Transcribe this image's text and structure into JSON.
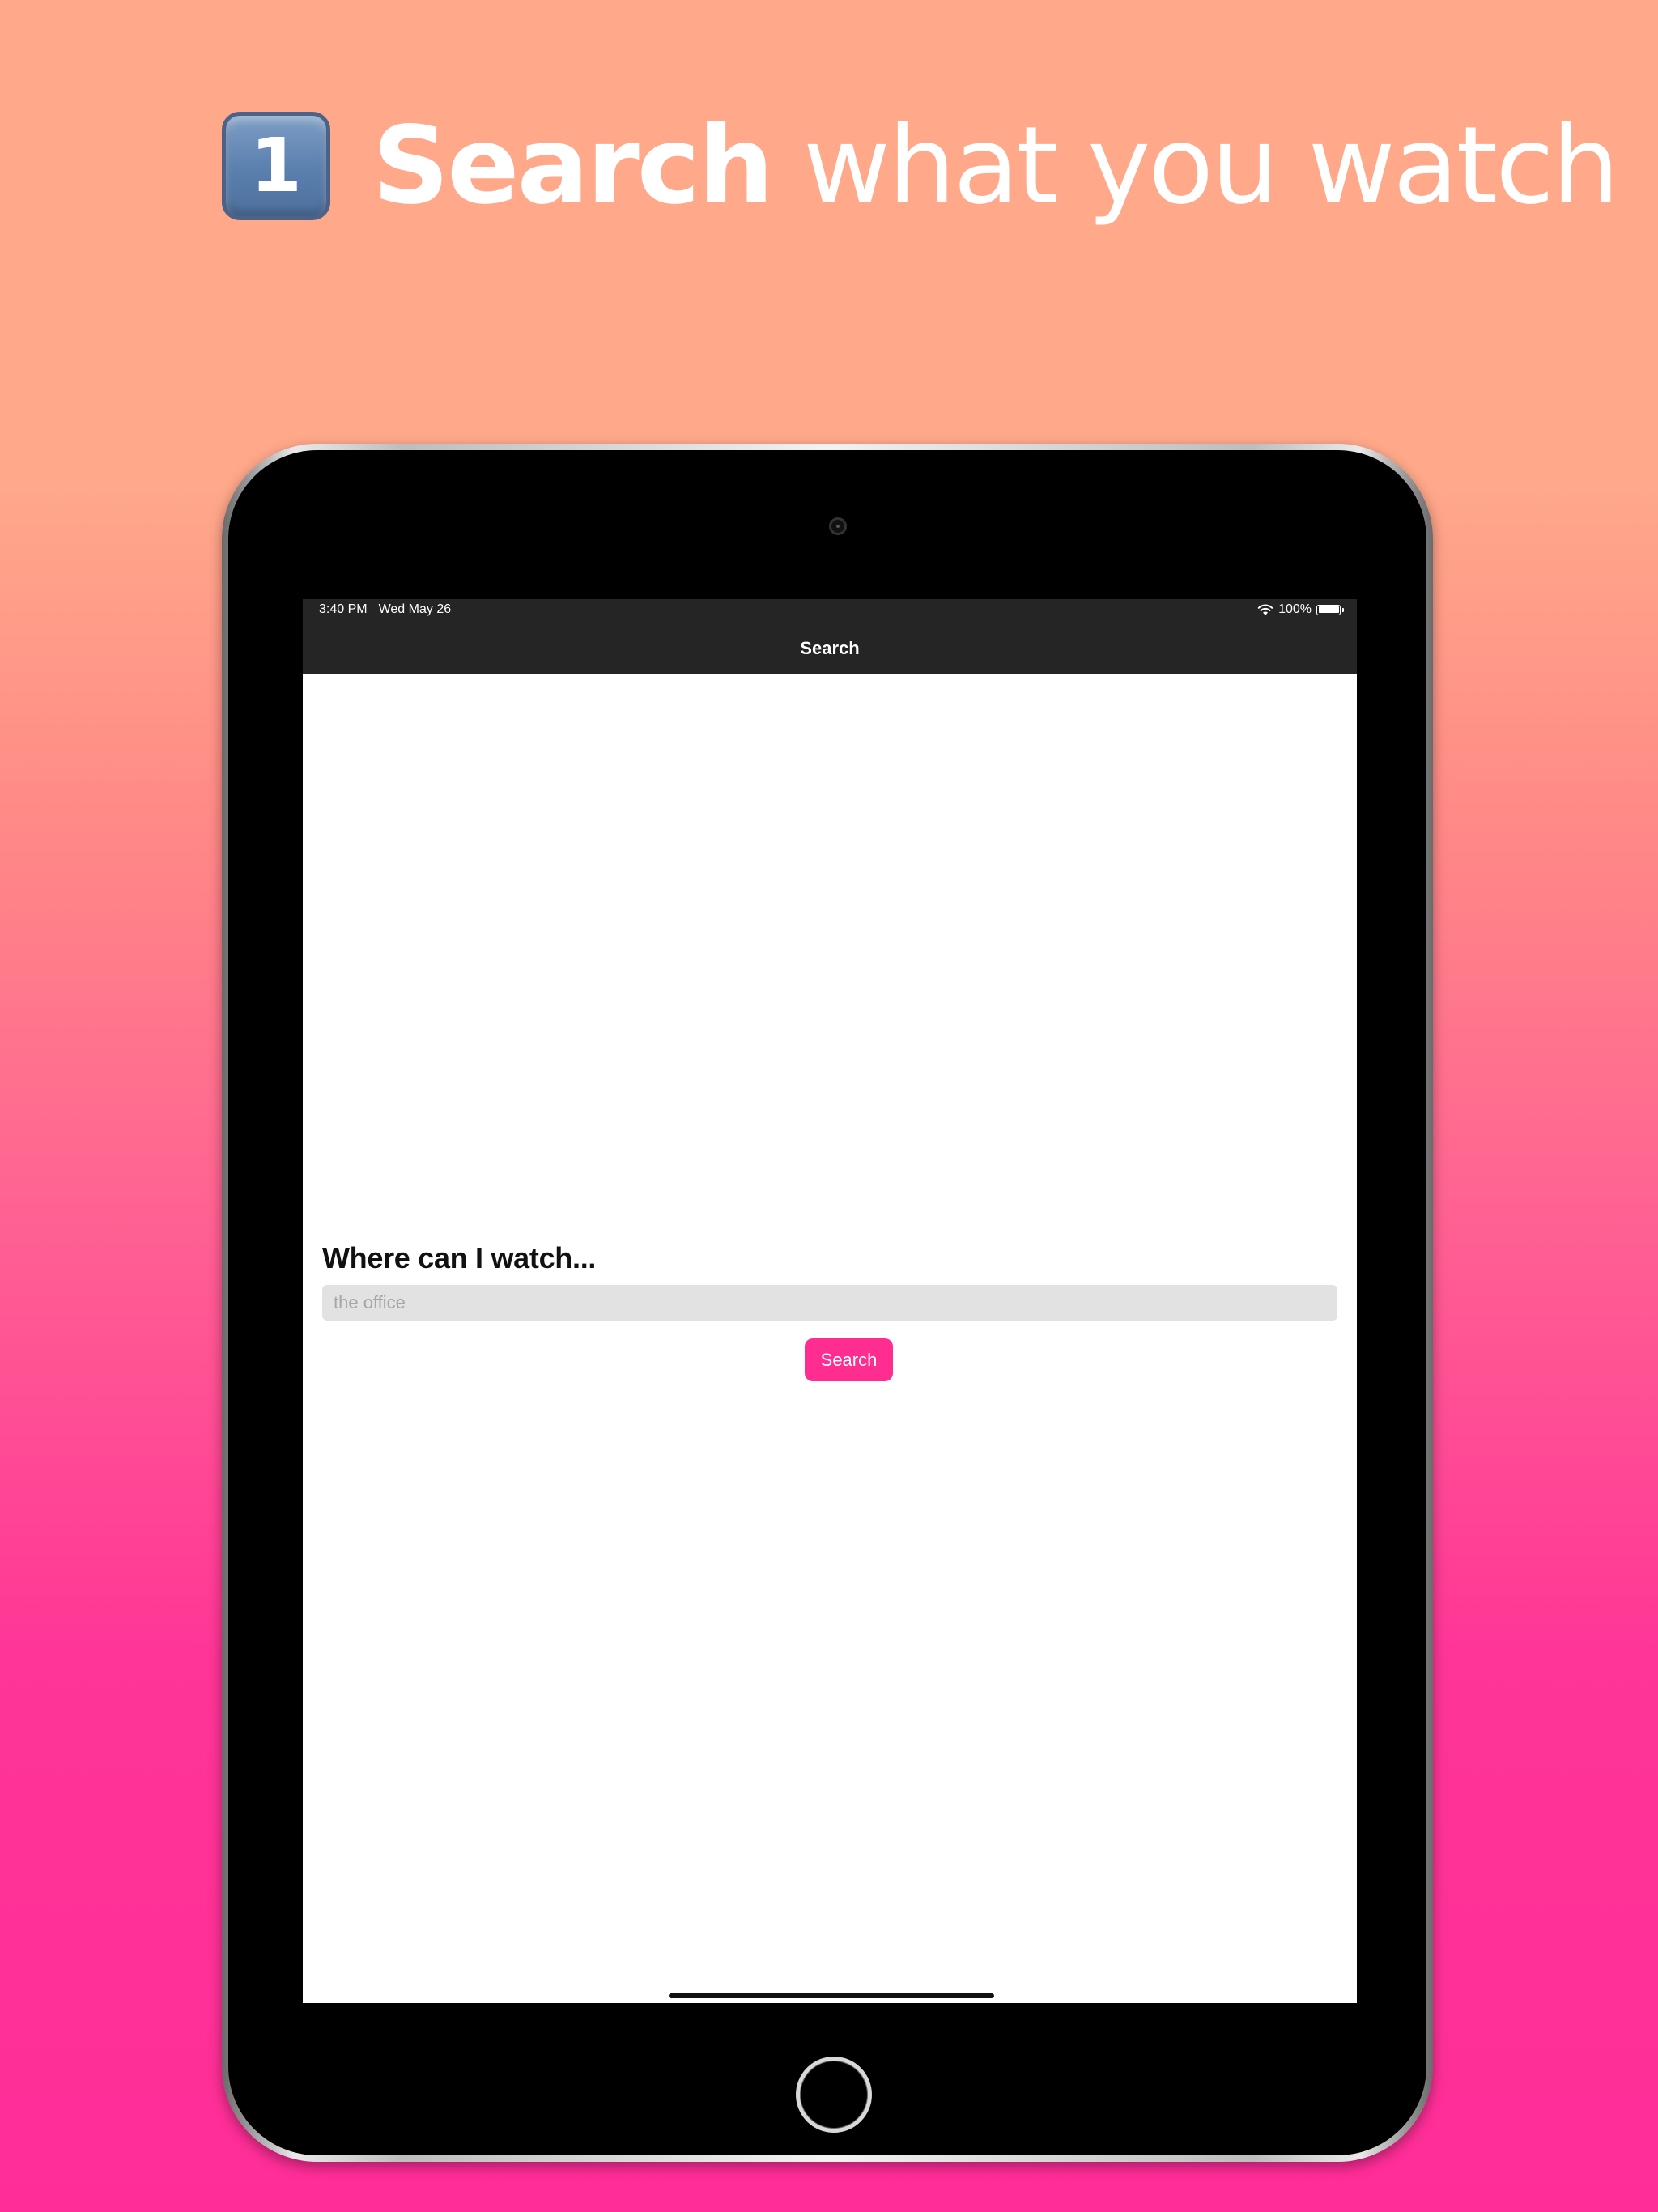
{
  "headline": {
    "step_number": "1",
    "bold_text": "Search",
    "light_text": " what you watch"
  },
  "status_bar": {
    "time": "3:40 PM",
    "date": "Wed May 26",
    "battery": "100%",
    "battery_level": 1.0
  },
  "nav": {
    "title": "Search"
  },
  "search_form": {
    "question": "Where can I watch...",
    "placeholder": "the office",
    "value": "",
    "button_label": "Search"
  },
  "colors": {
    "accent": "#FE2D8F",
    "background_top": "#FFA88A",
    "background_bottom": "#FF2D98",
    "nav_background": "#252525",
    "input_background": "#E2E2E2"
  },
  "icons": [
    "keycap-one-icon",
    "wifi-icon",
    "battery-icon",
    "camera-icon",
    "home-button-icon"
  ]
}
